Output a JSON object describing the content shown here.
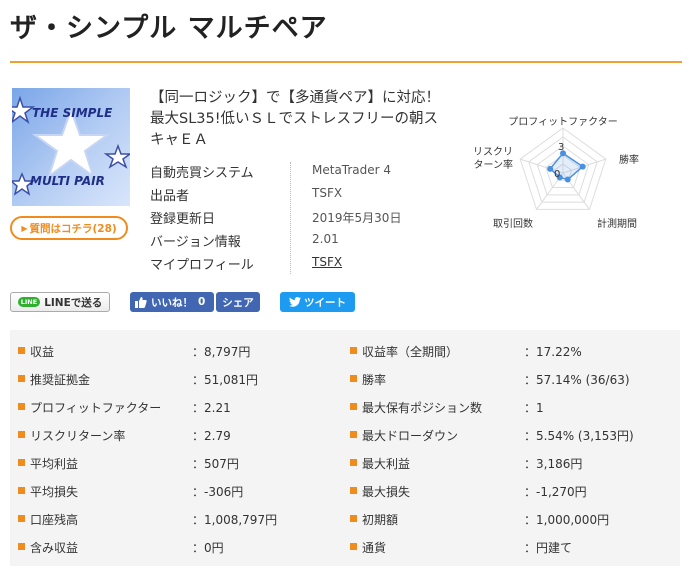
{
  "title": "ザ・シンプル マルチペア",
  "product": {
    "image_text": [
      "THE SIMPLE",
      "MULTI PAIR"
    ],
    "question_button": "質問はコチラ(28)",
    "headline": "【同一ロジック】で【多通貨ペア】に対応！最大SL35!低いＳＬでストレスフリーの朝スキャＥＡ",
    "info": [
      {
        "label": "自動売買システム",
        "value": "MetaTrader 4"
      },
      {
        "label": "出品者",
        "value": "TSFX"
      },
      {
        "label": "登録更新日",
        "value": "2019年5月30日"
      },
      {
        "label": "バージョン情報",
        "value": "2.01"
      },
      {
        "label": "マイプロフィール",
        "value": "TSFX"
      }
    ]
  },
  "chart_data": {
    "type": "radar",
    "axes": [
      "プロフィットファクター",
      "勝率",
      "計測期間",
      "取引回数",
      "リスクリターン率"
    ],
    "scale_labels": [
      "3",
      "0"
    ],
    "range": [
      0,
      5
    ],
    "values": [
      2.2,
      2.3,
      0.9,
      0.6,
      1.5
    ],
    "series_color": "#4a90e2"
  },
  "share": {
    "line": "LINEで送る",
    "line_badge": "LINE",
    "like": "いいね！",
    "like_count": "0",
    "share": "シェア",
    "tweet": "ツイート"
  },
  "stats": {
    "left": [
      {
        "label": "収益",
        "value": "：8,797円"
      },
      {
        "label": "推奨証拠金",
        "value": "：51,081円"
      },
      {
        "label": "プロフィットファクター",
        "value": "：2.21"
      },
      {
        "label": "リスクリターン率",
        "value": "：2.79"
      },
      {
        "label": "平均利益",
        "value": "：507円"
      },
      {
        "label": "平均損失",
        "value": "：-306円"
      },
      {
        "label": "口座残高",
        "value": "：1,008,797円"
      },
      {
        "label": "含み収益",
        "value": "：0円"
      }
    ],
    "right": [
      {
        "label": "収益率（全期間）",
        "value": "：17.22%"
      },
      {
        "label": "勝率",
        "value": "：57.14% (36/63)"
      },
      {
        "label": "最大保有ポジション数",
        "value": "：1"
      },
      {
        "label": "最大ドローダウン",
        "value": "：5.54% (3,153円)"
      },
      {
        "label": "最大利益",
        "value": "：3,186円"
      },
      {
        "label": "最大損失",
        "value": "：-1,270円"
      },
      {
        "label": "初期額",
        "value": "：1,000,000円"
      },
      {
        "label": "通貨",
        "value": "：円建て"
      }
    ]
  },
  "colors": {
    "accent": "#f08c1e",
    "facebook": "#4267b2",
    "twitter": "#1d9bf0",
    "line": "#2fb12f"
  }
}
